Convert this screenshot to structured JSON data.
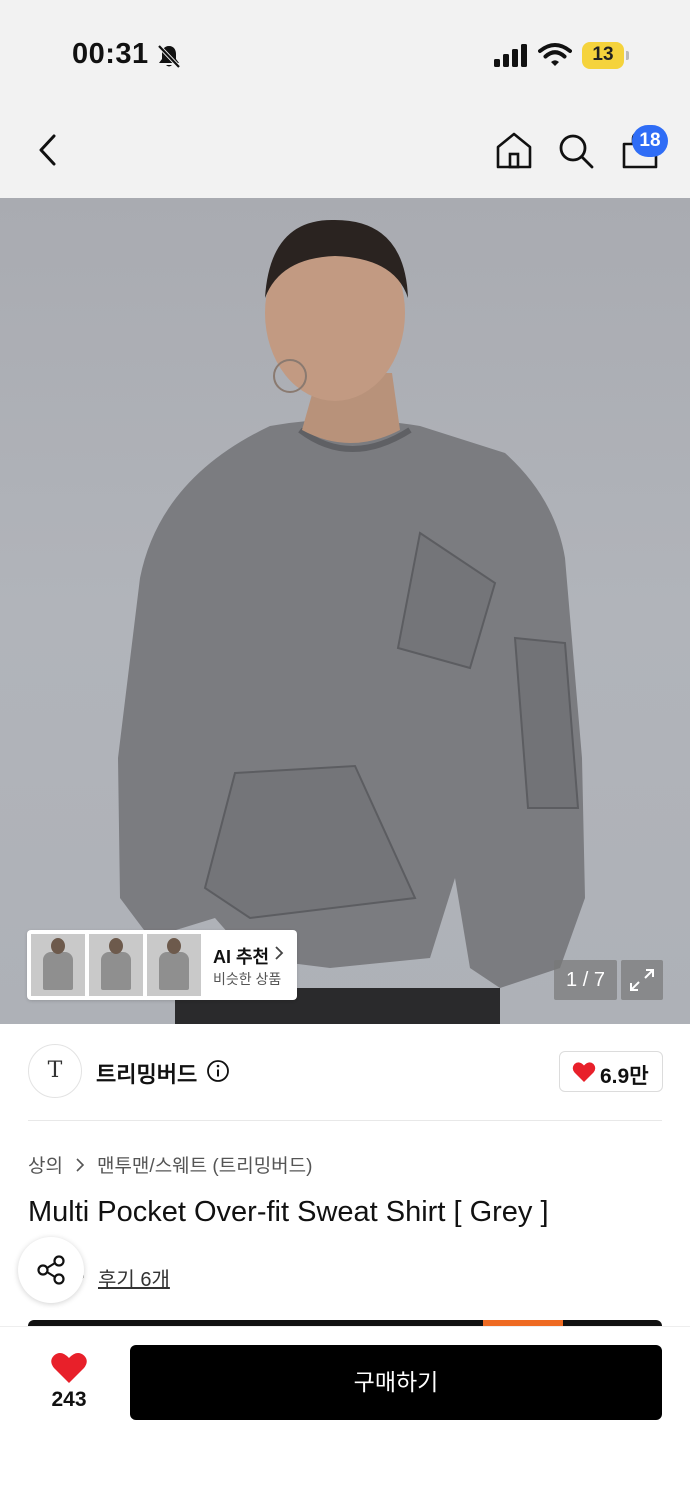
{
  "status_bar": {
    "time": "00:31",
    "battery": "13",
    "icons": [
      "bell-off-icon",
      "signal-icon",
      "wifi-icon",
      "battery-icon"
    ]
  },
  "nav": {
    "icons": [
      "back-icon",
      "home-icon",
      "search-icon",
      "cart-icon"
    ],
    "cart_count": "18",
    "badge_color": "#2f6df6"
  },
  "gallery": {
    "ai_recommend_title": "AI 추천",
    "ai_recommend_subtitle": "비슷한 상품",
    "page_indicator": "1 / 7"
  },
  "brand": {
    "logo_text": "T",
    "name": "트리밍버드",
    "like_count": "6.9만"
  },
  "product": {
    "breadcrumb": [
      "상의",
      "맨투맨/스웨트 (트리밍버드)"
    ],
    "title": "Multi Pocket Over-fit Sweat Shirt [ Grey ]",
    "rating": ".3",
    "review_text": "후기 6개"
  },
  "bottom_bar": {
    "wish_count": "243",
    "buy_label": "구매하기"
  },
  "colors": {
    "heart": "#e8202a",
    "buy_button": "#000000",
    "promo_accent": "#ee6a22"
  }
}
